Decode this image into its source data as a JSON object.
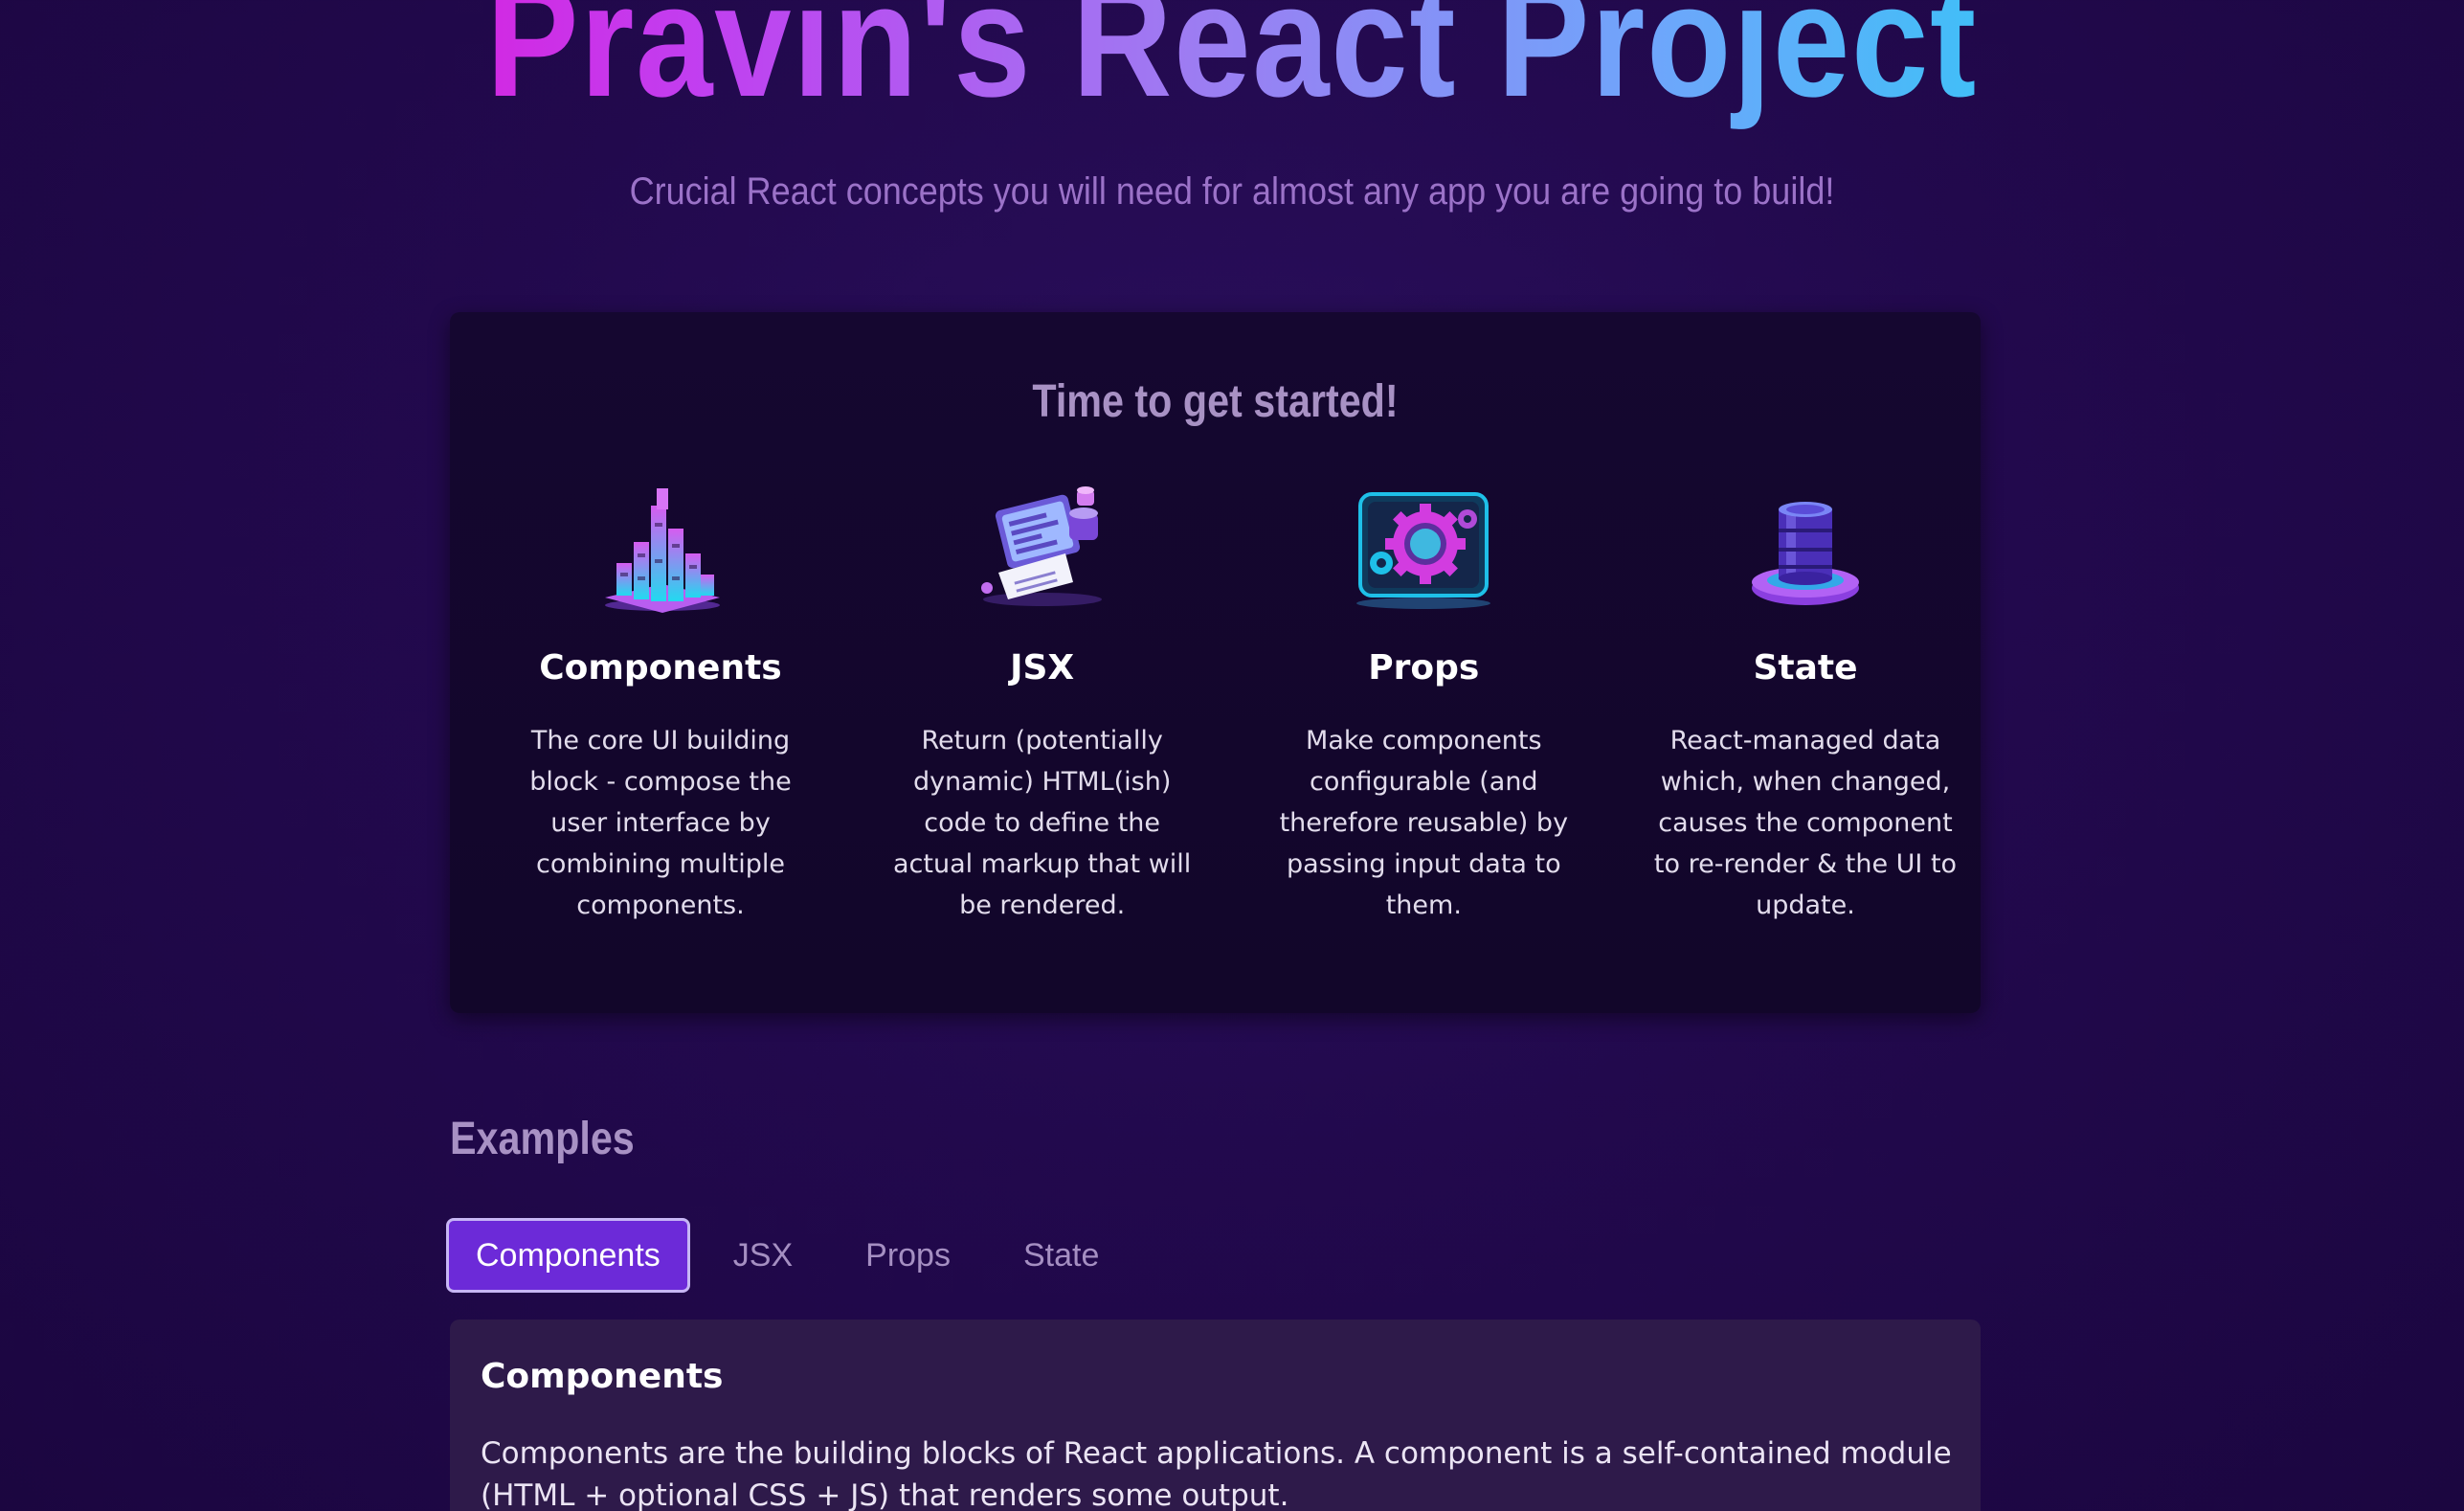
{
  "header": {
    "title": "Pravin's React Project",
    "subtitle": "Crucial React concepts you will need for almost any app you are going to build!"
  },
  "intro": {
    "heading": "Time to get started!",
    "concepts": [
      {
        "icon": "components-blocks-icon",
        "title": "Components",
        "description": "The core UI building block - compose the user interface by combining multiple components."
      },
      {
        "icon": "jsx-document-icon",
        "title": "JSX",
        "description": "Return (potentially dynamic) HTML(ish) code to define the actual markup that will be rendered."
      },
      {
        "icon": "props-gears-icon",
        "title": "Props",
        "description": "Make components configurable (and therefore reusable) by passing input data to them."
      },
      {
        "icon": "state-database-icon",
        "title": "State",
        "description": "React-managed data which, when changed, causes the component to re-render & the UI to update."
      }
    ]
  },
  "examples": {
    "heading": "Examples",
    "tabs": [
      {
        "label": "Components",
        "active": true
      },
      {
        "label": "JSX",
        "active": false
      },
      {
        "label": "Props",
        "active": false
      },
      {
        "label": "State",
        "active": false
      }
    ],
    "content": {
      "title": "Components",
      "text": "Components are the building blocks of React applications. A component is a self-contained module (HTML + optional CSS + JS) that renders some output."
    }
  },
  "colors": {
    "background": "#22094d",
    "card": "#13062b",
    "tab_active": "#6c2ad8",
    "tab_content": "#2e1a4a",
    "title_gradient": [
      "#e80bd0",
      "#9d7cf2",
      "#16d6f4"
    ]
  }
}
